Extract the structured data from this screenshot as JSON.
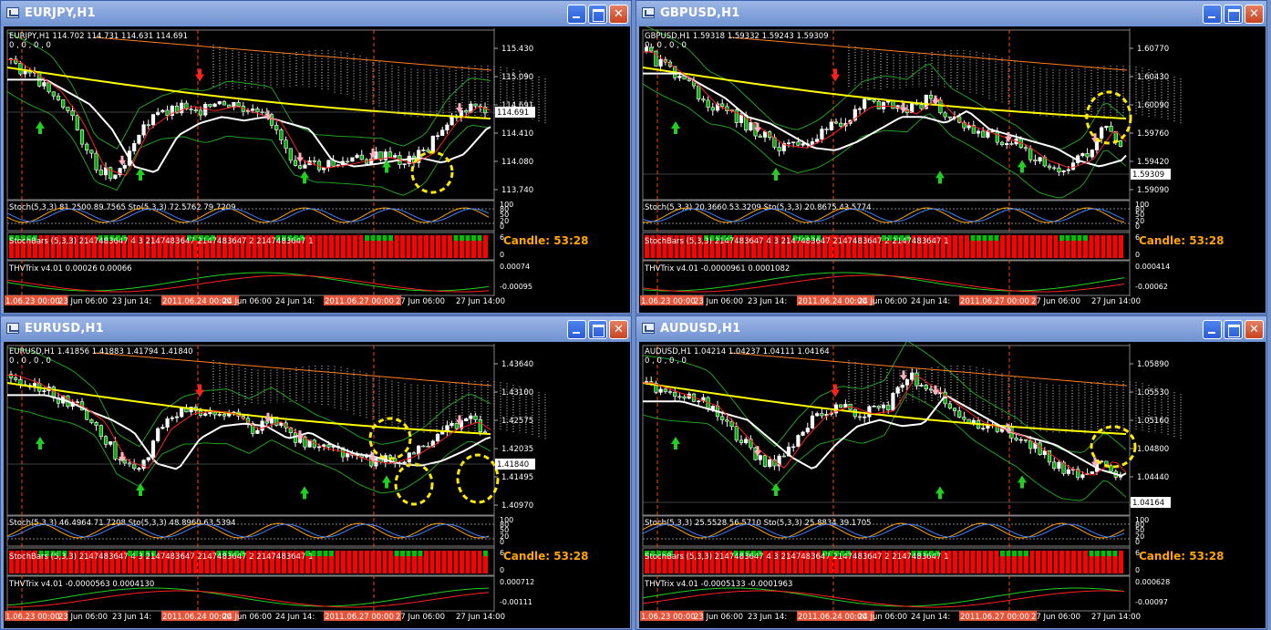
{
  "windows": [
    {
      "title": "EURJPY,H1",
      "ohlc": "EURJPY,H1  114.702 114.731 114.631 114.691",
      "zeros": "0 , 0 , 0 , 0",
      "price_ticks": [
        "115.430",
        "115.090",
        "114.691",
        "114.410",
        "114.080",
        "113.740"
      ],
      "current_price": "114.691",
      "stoch_label": "Stoch(5,3,3) 81.2500 89.7565  Sto(5,3,3) 72.5762 79.7209",
      "stoch_ticks": [
        "100",
        "80",
        "50",
        "20",
        "0"
      ],
      "stochbars_label": "StochBars (5,3,3) 2147483647 4 3 2147483647 2147483647 2 2147483647 1",
      "stochbars_ticks": [
        "6",
        "0"
      ],
      "candle": "Candle:  53:28",
      "trix_label": "THVTrix v4.01 0.00026 0.00066",
      "trix_ticks": [
        "0.00074",
        "-0.00095"
      ],
      "dates": [
        "1.06.23 00:00",
        "23 Jun 06:00",
        "23 Jun 14:",
        "2011.06.24 00:00",
        "24 Jun 06:00",
        "24 Jun 14:",
        "2011.06.27 00:00",
        "27 Jun 06:00",
        "27 Jun 14:00"
      ],
      "dates_highlighted": [
        0,
        3,
        6
      ]
    },
    {
      "title": "GBPUSD,H1",
      "ohlc": "GBPUSD,H1  1.59318 1.59332 1.59243 1.59309",
      "zeros": "0 , 0 , 0 , 0",
      "price_ticks": [
        "1.60770",
        "1.60430",
        "1.60090",
        "1.59760",
        "1.59420",
        "1.59090"
      ],
      "current_price": "1.59309",
      "stoch_label": "Stoch(5,3,3) 20.3660 53.3209  Sto(5,3,3) 20.8675 43.5774",
      "stoch_ticks": [
        "100",
        "80",
        "50",
        "20",
        "0"
      ],
      "stochbars_label": "StochBars (5,3,3) 2147483647 4 3 2147483647 2147483647 2 2147483647 1",
      "stochbars_ticks": [
        "6",
        "0"
      ],
      "candle": "Candle:  53:28",
      "trix_label": "THVTrix v4.01 -0.0000961 0.0001082",
      "trix_ticks": [
        "0.000414",
        "-0.00062"
      ],
      "dates": [
        "1.06.23 00:00",
        "23 Jun 06:00",
        "23 Jun 14:",
        "2011.06.24 00:00",
        "24 Jun 06:00",
        "24 Jun 14:",
        "2011.06.27 00:00",
        "27 Jun 06:00",
        "27 Jun 14:00"
      ],
      "dates_highlighted": [
        0,
        3,
        6
      ]
    },
    {
      "title": "EURUSD,H1",
      "ohlc": "EURUSD,H1  1.41856 1.41883 1.41794 1.41840",
      "zeros": "0 , 0 , 0 , 0",
      "price_ticks": [
        "1.43640",
        "1.43100",
        "1.42575",
        "1.42035",
        "1.41495",
        "1.40970"
      ],
      "current_price": "1.41840",
      "stoch_label": "Stoch(5,3,3) 46.4964 71.7208  Sto(5,3,3) 48.8960 63.5394",
      "stoch_ticks": [
        "100",
        "80",
        "50",
        "20",
        "0"
      ],
      "stochbars_label": "StochBars (5,3,3) 2147483647 4 3 2147483647 2147483647 2 2147483647 1",
      "stochbars_ticks": [
        "6",
        "0"
      ],
      "candle": "Candle:  53:28",
      "trix_label": "THVTrix v4.01 -0.0000563 0.0004130",
      "trix_ticks": [
        "0.000712",
        "-0.00111"
      ],
      "dates": [
        "1.06.23 00:00",
        "23 Jun 06:00",
        "23 Jun 14:",
        "2011.06.24 00:00",
        "24 Jun 06:00",
        "24 Jun 14:",
        "2011.06.27 00:00",
        "27 Jun 06:00",
        "27 Jun 14:00"
      ],
      "dates_highlighted": [
        0,
        3,
        6
      ]
    },
    {
      "title": "AUDUSD,H1",
      "ohlc": "AUDUSD,H1  1.04214 1.04237 1.04111 1.04164",
      "zeros": "0 , 0 , 0 , 0",
      "price_ticks": [
        "1.05890",
        "1.05530",
        "1.05160",
        "1.04800",
        "1.04440",
        "1.04080"
      ],
      "current_price": "1.04164",
      "stoch_label": "Stoch(5,3,3) 25.5528 56.5710  Sto(5,3,3) 25.8834 39.1705",
      "stoch_ticks": [
        "100",
        "80",
        "50",
        "20",
        "0"
      ],
      "stochbars_label": "StochBars (5,3,3) 2147483647 4 3 2147483647 2147483647 2 2147483647 1",
      "stochbars_ticks": [
        "6",
        "0"
      ],
      "candle": "Candle:  53:28",
      "trix_label": "THVTrix v4.01 -0.0005133 -0.0001963",
      "trix_ticks": [
        "0.000628",
        "-0.00097"
      ],
      "dates": [
        "1.06.23 00:00",
        "23 Jun 06:00",
        "23 Jun 14:",
        "2011.06.24 00:00",
        "24 Jun 06:00",
        "24 Jun 14:",
        "2011.06.27 00:00",
        "27 Jun 06:00",
        "27 Jun 14:00"
      ],
      "dates_highlighted": [
        0,
        3,
        6
      ]
    }
  ],
  "colors": {
    "bull_candle": "#ffffff",
    "bear_candle": "#00b000",
    "ma_slow": "#ffff00",
    "ma_mid": "#ffffff",
    "ma_fast": "#ff2020",
    "band": "#20a020",
    "cloud": "#ffffff",
    "stochbar_up": "#00c000",
    "stochbar_down": "#ff0000",
    "session_line": "#ff4500",
    "highlight_ring": "#ffeb00",
    "candle_timer": "#ffa500"
  },
  "window_buttons": {
    "minimize": "minimize",
    "maximize": "maximize",
    "close": "close"
  }
}
